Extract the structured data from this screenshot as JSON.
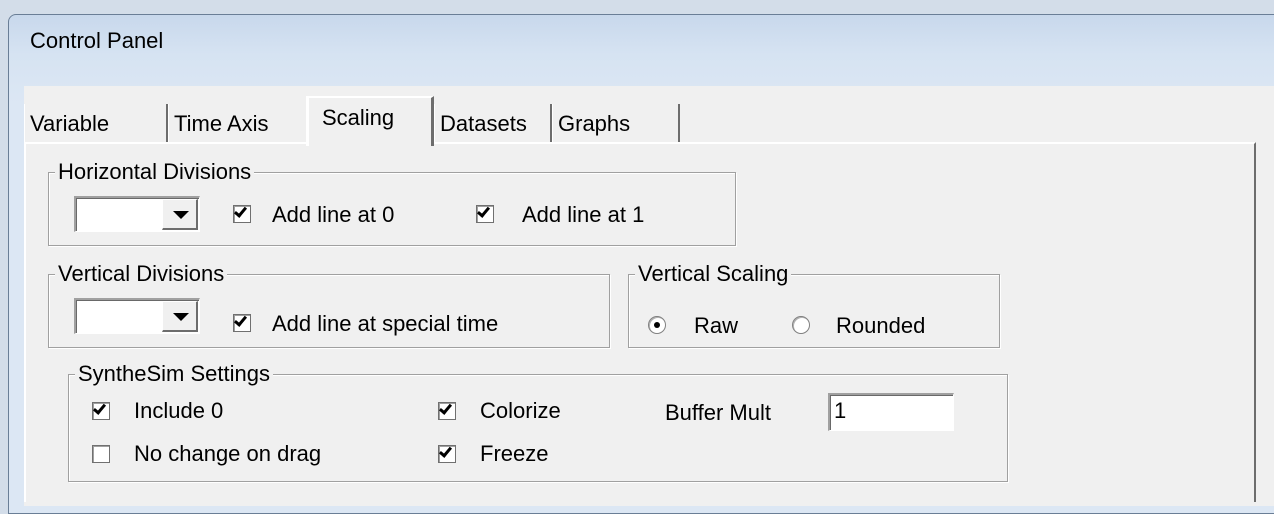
{
  "window": {
    "title": "Control Panel"
  },
  "tabs": [
    {
      "label": "Variable",
      "selected": false
    },
    {
      "label": "Time Axis",
      "selected": false
    },
    {
      "label": "Scaling",
      "selected": true
    },
    {
      "label": "Datasets",
      "selected": false
    },
    {
      "label": "Graphs",
      "selected": false
    }
  ],
  "horizontal_divisions": {
    "legend": "Horizontal Divisions",
    "combo_value": "",
    "add_line_0": {
      "label": "Add line at 0",
      "checked": true
    },
    "add_line_1": {
      "label": "Add line at 1",
      "checked": true
    }
  },
  "vertical_divisions": {
    "legend": "Vertical Divisions",
    "combo_value": "",
    "add_line_special": {
      "label": "Add line at special time",
      "checked": true
    }
  },
  "vertical_scaling": {
    "legend": "Vertical Scaling",
    "raw": {
      "label": "Raw",
      "selected": true
    },
    "rounded": {
      "label": "Rounded",
      "selected": false
    }
  },
  "synthesim": {
    "legend": "SyntheSim Settings",
    "include_0": {
      "label": "Include 0",
      "checked": true
    },
    "no_change_on_drag": {
      "label": "No change on drag",
      "checked": false
    },
    "colorize": {
      "label": "Colorize",
      "checked": true
    },
    "freeze": {
      "label": "Freeze",
      "checked": true
    },
    "buffer_mult": {
      "label": "Buffer Mult",
      "value": "1"
    }
  }
}
